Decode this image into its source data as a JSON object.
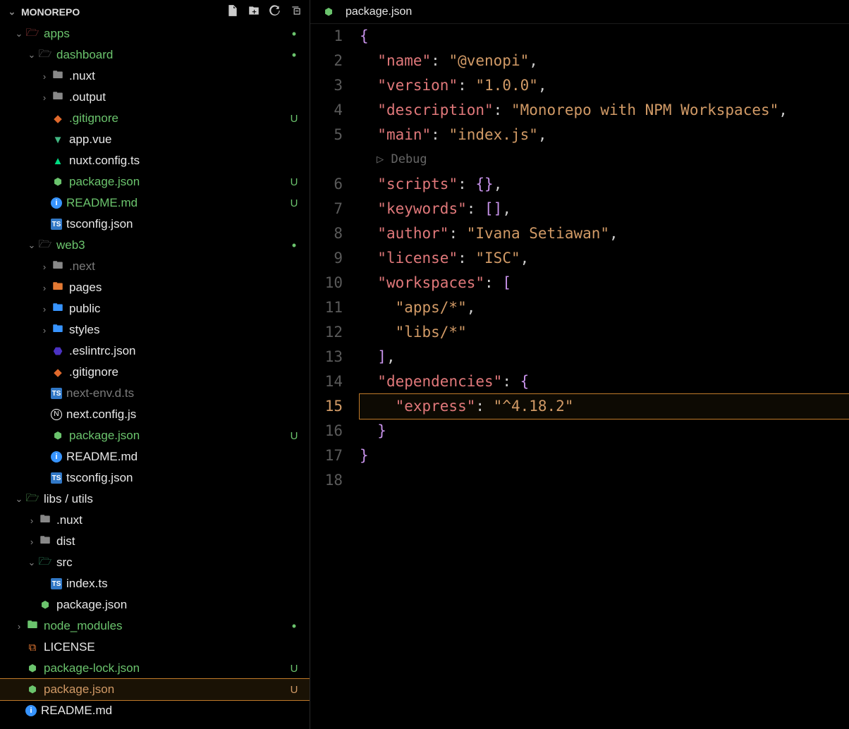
{
  "sidebar": {
    "title": "MONOREPO",
    "tree": [
      {
        "d": 0,
        "tw": "v",
        "ic": "folder-open-red",
        "name": "apps",
        "cls": "folder-green",
        "st": "dot",
        "stc": "green",
        "sel": false
      },
      {
        "d": 1,
        "tw": "v",
        "ic": "folder-open",
        "name": "dashboard",
        "cls": "folder-green",
        "st": "dot",
        "stc": "green",
        "sel": false
      },
      {
        "d": 2,
        "tw": ">",
        "ic": "folder",
        "name": ".nuxt",
        "cls": "white",
        "st": "",
        "stc": "",
        "sel": false
      },
      {
        "d": 2,
        "tw": ">",
        "ic": "folder",
        "name": ".output",
        "cls": "white",
        "st": "",
        "stc": "",
        "sel": false
      },
      {
        "d": 2,
        "tw": "",
        "ic": "git",
        "name": ".gitignore",
        "cls": "green",
        "st": "U",
        "stc": "green",
        "sel": false
      },
      {
        "d": 2,
        "tw": "",
        "ic": "vue",
        "name": "app.vue",
        "cls": "white",
        "st": "",
        "stc": "",
        "sel": false
      },
      {
        "d": 2,
        "tw": "",
        "ic": "nuxt",
        "name": "nuxt.config.ts",
        "cls": "white",
        "st": "",
        "stc": "",
        "sel": false
      },
      {
        "d": 2,
        "tw": "",
        "ic": "js",
        "name": "package.json",
        "cls": "green",
        "st": "U",
        "stc": "green",
        "sel": false
      },
      {
        "d": 2,
        "tw": "",
        "ic": "info",
        "name": "README.md",
        "cls": "green",
        "st": "U",
        "stc": "green",
        "sel": false
      },
      {
        "d": 2,
        "tw": "",
        "ic": "ts",
        "name": "tsconfig.json",
        "cls": "white",
        "st": "",
        "stc": "",
        "sel": false
      },
      {
        "d": 1,
        "tw": "v",
        "ic": "folder-open",
        "name": "web3",
        "cls": "folder-green",
        "st": "dot",
        "stc": "green",
        "sel": false
      },
      {
        "d": 2,
        "tw": ">",
        "ic": "folder",
        "name": ".next",
        "cls": "muted",
        "st": "",
        "stc": "",
        "sel": false
      },
      {
        "d": 2,
        "tw": ">",
        "ic": "pages",
        "name": "pages",
        "cls": "white",
        "st": "",
        "stc": "",
        "sel": false
      },
      {
        "d": 2,
        "tw": ">",
        "ic": "public",
        "name": "public",
        "cls": "white",
        "st": "",
        "stc": "",
        "sel": false
      },
      {
        "d": 2,
        "tw": ">",
        "ic": "styles",
        "name": "styles",
        "cls": "white",
        "st": "",
        "stc": "",
        "sel": false
      },
      {
        "d": 2,
        "tw": "",
        "ic": "eslint",
        "name": ".eslintrc.json",
        "cls": "white",
        "st": "",
        "stc": "",
        "sel": false
      },
      {
        "d": 2,
        "tw": "",
        "ic": "git",
        "name": ".gitignore",
        "cls": "white",
        "st": "",
        "stc": "",
        "sel": false
      },
      {
        "d": 2,
        "tw": "",
        "ic": "ts",
        "name": "next-env.d.ts",
        "cls": "muted",
        "st": "",
        "stc": "",
        "sel": false
      },
      {
        "d": 2,
        "tw": "",
        "ic": "next",
        "name": "next.config.js",
        "cls": "white",
        "st": "",
        "stc": "",
        "sel": false
      },
      {
        "d": 2,
        "tw": "",
        "ic": "js",
        "name": "package.json",
        "cls": "green",
        "st": "U",
        "stc": "green",
        "sel": false
      },
      {
        "d": 2,
        "tw": "",
        "ic": "info",
        "name": "README.md",
        "cls": "white",
        "st": "",
        "stc": "",
        "sel": false
      },
      {
        "d": 2,
        "tw": "",
        "ic": "ts",
        "name": "tsconfig.json",
        "cls": "white",
        "st": "",
        "stc": "",
        "sel": false
      },
      {
        "d": 0,
        "tw": "v",
        "ic": "folder-open-green",
        "name": "libs / utils",
        "cls": "white",
        "st": "",
        "stc": "",
        "sel": false
      },
      {
        "d": 1,
        "tw": ">",
        "ic": "folder",
        "name": ".nuxt",
        "cls": "white",
        "st": "",
        "stc": "",
        "sel": false
      },
      {
        "d": 1,
        "tw": ">",
        "ic": "folder",
        "name": "dist",
        "cls": "white",
        "st": "",
        "stc": "",
        "sel": false
      },
      {
        "d": 1,
        "tw": "v",
        "ic": "src",
        "name": "src",
        "cls": "white",
        "st": "",
        "stc": "",
        "sel": false
      },
      {
        "d": 2,
        "tw": "",
        "ic": "ts",
        "name": "index.ts",
        "cls": "white",
        "st": "",
        "stc": "",
        "sel": false
      },
      {
        "d": 1,
        "tw": "",
        "ic": "js",
        "name": "package.json",
        "cls": "white",
        "st": "",
        "stc": "",
        "sel": false
      },
      {
        "d": 0,
        "tw": ">",
        "ic": "folder-green-closed",
        "name": "node_modules",
        "cls": "folder-green",
        "st": "dot",
        "stc": "green",
        "sel": false
      },
      {
        "d": 0,
        "tw": "",
        "ic": "cert",
        "name": "LICENSE",
        "cls": "white",
        "st": "",
        "stc": "",
        "sel": false
      },
      {
        "d": 0,
        "tw": "",
        "ic": "js",
        "name": "package-lock.json",
        "cls": "green",
        "st": "U",
        "stc": "green",
        "sel": false
      },
      {
        "d": 0,
        "tw": "",
        "ic": "js",
        "name": "package.json",
        "cls": "orange",
        "st": "U",
        "stc": "orange",
        "sel": true
      },
      {
        "d": 0,
        "tw": "",
        "ic": "info",
        "name": "README.md",
        "cls": "white",
        "st": "",
        "stc": "",
        "sel": false
      }
    ]
  },
  "editor": {
    "tab": {
      "icon": "js",
      "label": "package.json"
    },
    "codelens": "▷ Debug",
    "current_line": 15,
    "lines": [
      {
        "n": 1,
        "html": "<span class='tok-brace'>{</span>"
      },
      {
        "n": 2,
        "html": "  <span class='tok-key'>\"name\"</span><span class='tok-punc'>: </span><span class='tok-str'>\"@venopi\"</span><span class='tok-punc'>,</span>"
      },
      {
        "n": 3,
        "html": "  <span class='tok-key'>\"version\"</span><span class='tok-punc'>: </span><span class='tok-str'>\"1.0.0\"</span><span class='tok-punc'>,</span>"
      },
      {
        "n": 4,
        "html": "  <span class='tok-key'>\"description\"</span><span class='tok-punc'>: </span><span class='tok-str'>\"Monorepo with NPM Workspaces\"</span><span class='tok-punc'>,</span>"
      },
      {
        "n": 5,
        "html": "  <span class='tok-key'>\"main\"</span><span class='tok-punc'>: </span><span class='tok-str'>\"index.js\"</span><span class='tok-punc'>,</span>"
      },
      {
        "n": 6,
        "html": "  <span class='tok-key'>\"scripts\"</span><span class='tok-punc'>: </span><span class='tok-brace'>{}</span><span class='tok-punc'>,</span>"
      },
      {
        "n": 7,
        "html": "  <span class='tok-key'>\"keywords\"</span><span class='tok-punc'>: </span><span class='tok-arr'>[]</span><span class='tok-punc'>,</span>"
      },
      {
        "n": 8,
        "html": "  <span class='tok-key'>\"author\"</span><span class='tok-punc'>: </span><span class='tok-str'>\"Ivana Setiawan\"</span><span class='tok-punc'>,</span>"
      },
      {
        "n": 9,
        "html": "  <span class='tok-key'>\"license\"</span><span class='tok-punc'>: </span><span class='tok-str'>\"ISC\"</span><span class='tok-punc'>,</span>"
      },
      {
        "n": 10,
        "html": "  <span class='tok-key'>\"workspaces\"</span><span class='tok-punc'>: </span><span class='tok-arr'>[</span>"
      },
      {
        "n": 11,
        "html": "    <span class='tok-str'>\"apps/*\"</span><span class='tok-punc'>,</span>"
      },
      {
        "n": 12,
        "html": "    <span class='tok-str'>\"libs/*\"</span>"
      },
      {
        "n": 13,
        "html": "  <span class='tok-arr'>]</span><span class='tok-punc'>,</span>"
      },
      {
        "n": 14,
        "html": "  <span class='tok-key'>\"dependencies\"</span><span class='tok-punc'>: </span><span class='tok-brace'>{</span>"
      },
      {
        "n": 15,
        "html": "    <span class='tok-key'>\"express\"</span><span class='tok-punc'>: </span><span class='tok-str'>\"^4.18.2\"</span>"
      },
      {
        "n": 16,
        "html": "  <span class='tok-brace'>}</span>"
      },
      {
        "n": 17,
        "html": "<span class='tok-brace'>}</span>"
      },
      {
        "n": 18,
        "html": ""
      }
    ]
  }
}
